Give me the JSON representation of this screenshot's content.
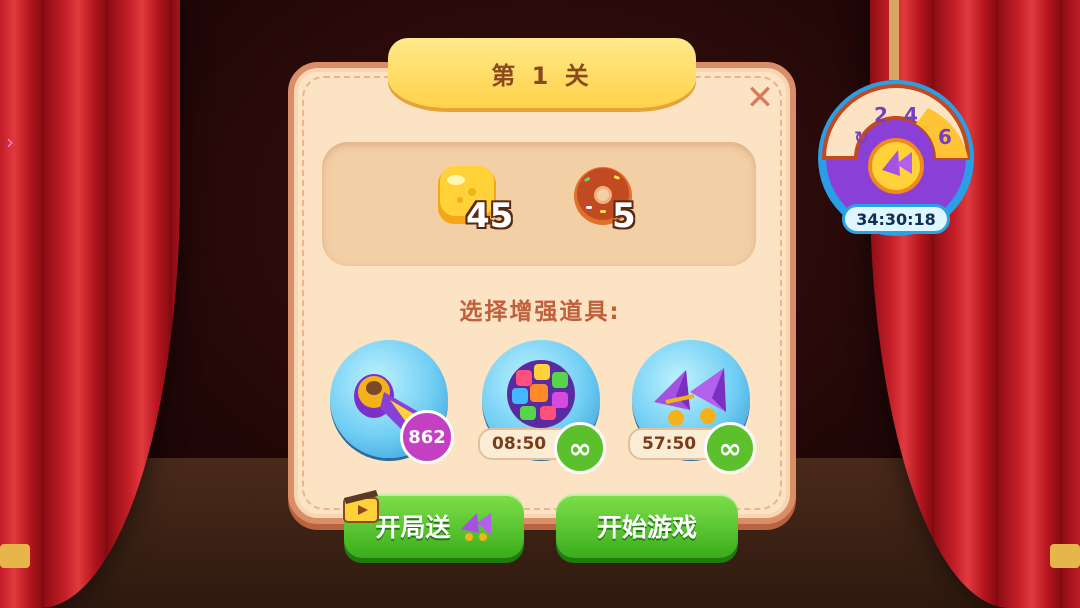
{
  "level": {
    "title": "第 1 关"
  },
  "goals": [
    {
      "item": "yellow-jelly-block",
      "count": "45"
    },
    {
      "item": "chocolate-donut",
      "count": "5"
    }
  ],
  "booster_prompt": "选择增强道具:",
  "boosters": [
    {
      "item": "drill-rocket-booster",
      "count": "862"
    },
    {
      "item": "rainbow-cube-ball-booster",
      "timer": "08:50",
      "infinite": "∞"
    },
    {
      "item": "purple-paper-plane-booster",
      "timer": "57:50",
      "infinite": "∞"
    }
  ],
  "buttons": {
    "bonus_start": "开局送",
    "start_game": "开始游戏"
  },
  "reward_wheel": {
    "segments": [
      "2",
      "4",
      "6"
    ],
    "timer": "34:30:18"
  },
  "colors": {
    "panel_bg": "#fbe3c3",
    "title_tab": "#ffd24a",
    "button_green": "#3aac1c",
    "curtain_red": "#c8202a"
  }
}
